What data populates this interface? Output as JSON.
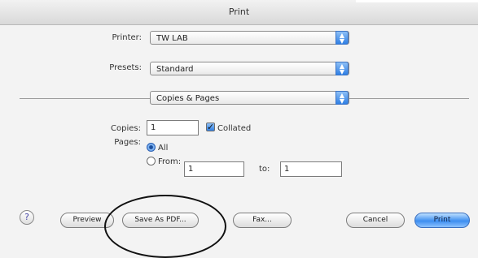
{
  "window": {
    "title": "Print"
  },
  "printer": {
    "label": "Printer:",
    "value": "TW LAB"
  },
  "presets": {
    "label": "Presets:",
    "value": "Standard"
  },
  "section": {
    "value": "Copies & Pages"
  },
  "copies": {
    "label": "Copies:",
    "value": "1",
    "collated_label": "Collated",
    "collated_checked": true
  },
  "pages": {
    "label": "Pages:",
    "all_label": "All",
    "from_label": "From:",
    "from_value": "1",
    "to_label": "to:",
    "to_value": "1",
    "selected": "All"
  },
  "buttons": {
    "help": "?",
    "preview": "Preview",
    "save_pdf": "Save As PDF...",
    "fax": "Fax...",
    "cancel": "Cancel",
    "print": "Print"
  },
  "icons": {
    "popup_arrow": "updown-chevron-icon",
    "check": "checkmark-icon"
  },
  "colors": {
    "accent": "#3d8ef0",
    "annotation": "#111111"
  }
}
